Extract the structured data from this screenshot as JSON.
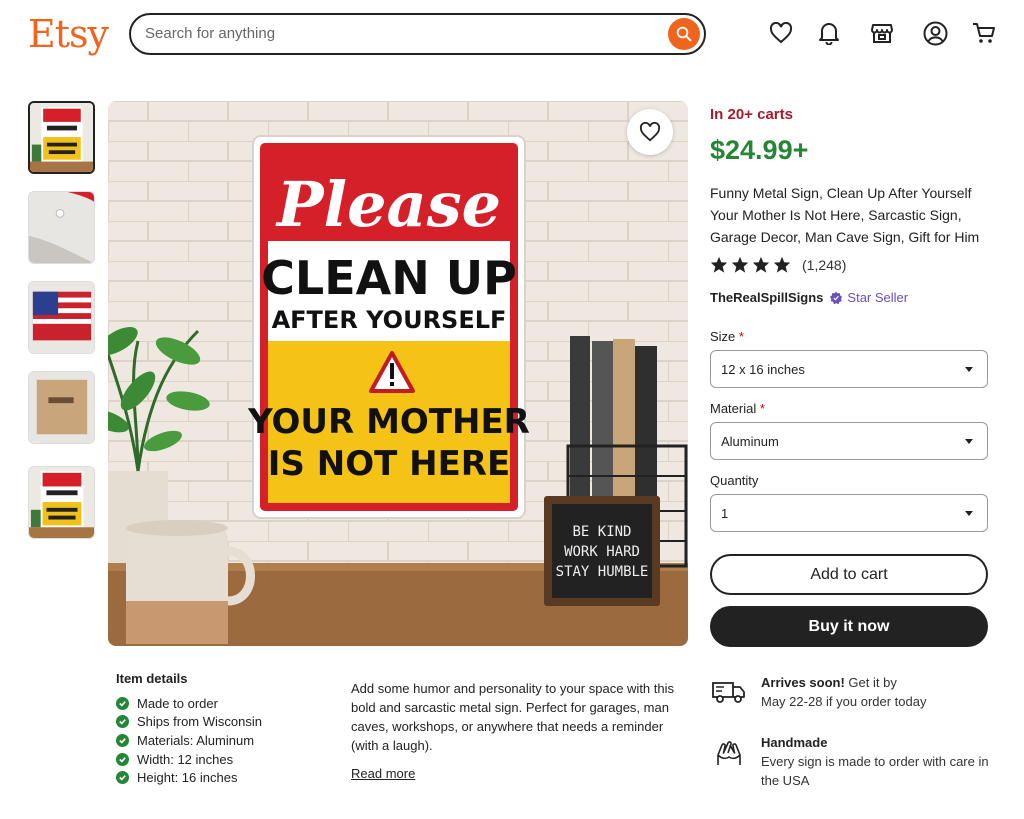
{
  "header": {
    "logo": "Etsy",
    "search_placeholder": "Search for anything"
  },
  "sign": {
    "line1": "Please",
    "line2": "CLEAN UP",
    "line3": "AFTER YOURSELF",
    "line4": "YOUR MOTHER",
    "line5": "IS NOT HERE"
  },
  "desk_sign": {
    "line1": "BE KIND",
    "line2": "WORK HARD",
    "line3": "STAY HUMBLE"
  },
  "product": {
    "carts": "In 20+ carts",
    "price": "$24.99+",
    "title": "Funny Metal Sign, Clean Up After Yourself Your Mother Is Not Here, Sarcastic Sign, Garage Decor, Man Cave Sign, Gift for Him",
    "rating_stars": 4,
    "reviews": "(1,248)",
    "seller": "TheRealSpillSigns",
    "seller_badge": "Star Seller"
  },
  "options": {
    "size_label": "Size",
    "size_value": "12 x 16 inches",
    "material_label": "Material",
    "material_value": "Aluminum",
    "quantity_label": "Quantity",
    "quantity_value": "1",
    "required_mark": "*"
  },
  "actions": {
    "add_to_cart": "Add to cart",
    "buy_now": "Buy it now"
  },
  "details": {
    "heading": "Item details",
    "items": [
      "Made to order",
      "Ships from Wisconsin",
      "Materials: Aluminum",
      "Width: 12 inches",
      "Height: 16 inches"
    ]
  },
  "description": {
    "text": "Add some humor and personality to your space with this bold and sarcastic metal sign. Perfect for garages, man caves, workshops, or anywhere that needs a reminder (with a laugh).",
    "read_more": "Read more"
  },
  "shipping": {
    "title": "Arrives soon!",
    "text_inline": " Get it by",
    "text": "May 22-28 if you order today"
  },
  "handmade": {
    "title": "Handmade",
    "text": "Every sign is made to order with care in the USA"
  },
  "colors": {
    "brand": "#f1641e",
    "price": "#258635",
    "carts": "#a61a2e",
    "star_seller": "#6b4fbb"
  }
}
